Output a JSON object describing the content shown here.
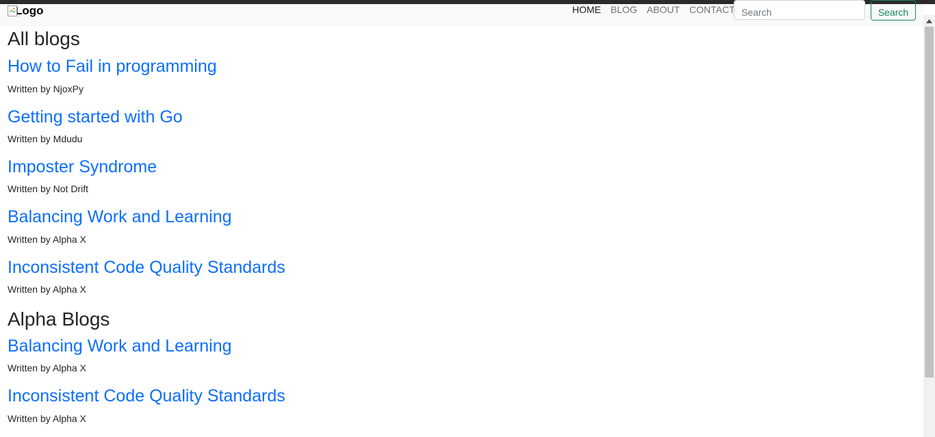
{
  "navbar": {
    "logo_alt": "Logo",
    "links": [
      {
        "label": "HOME"
      },
      {
        "label": "BLOG"
      },
      {
        "label": "ABOUT"
      },
      {
        "label": "CONTACT"
      }
    ],
    "search_placeholder": "Search",
    "search_button": "Search"
  },
  "sections": [
    {
      "heading": "All blogs",
      "posts": [
        {
          "title": "How to Fail in programming",
          "author": "Written by NjoxPy"
        },
        {
          "title": "Getting started with Go",
          "author": "Written by Mdudu"
        },
        {
          "title": "Imposter Syndrome",
          "author": "Written by Not Drift"
        },
        {
          "title": "Balancing Work and Learning",
          "author": "Written by Alpha X"
        },
        {
          "title": "Inconsistent Code Quality Standards",
          "author": "Written by Alpha X"
        }
      ]
    },
    {
      "heading": "Alpha Blogs",
      "posts": [
        {
          "title": "Balancing Work and Learning",
          "author": "Written by Alpha X"
        },
        {
          "title": "Inconsistent Code Quality Standards",
          "author": "Written by Alpha X"
        }
      ]
    }
  ],
  "colors": {
    "link": "#0d6efd",
    "success": "#198754",
    "navbar_bg": "#f8f9fa"
  }
}
